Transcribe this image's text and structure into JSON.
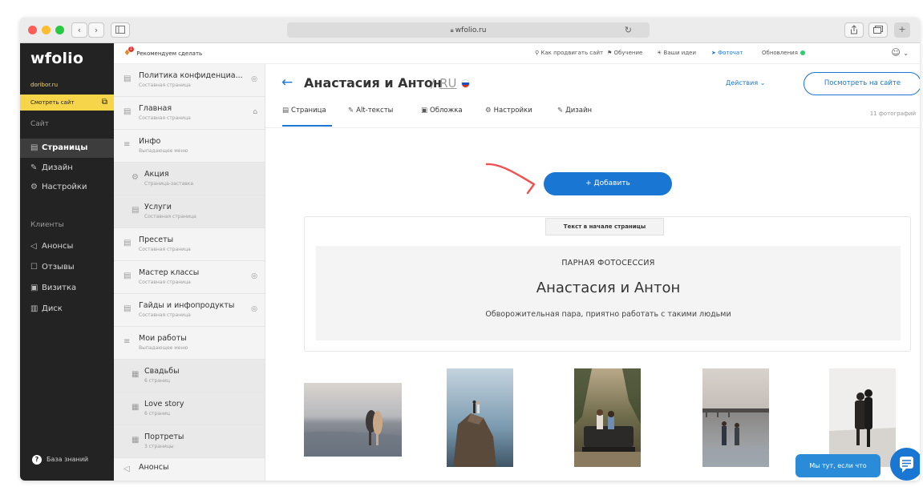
{
  "browser": {
    "url": "wfolio.ru",
    "nav_back": "‹",
    "nav_forward": "›"
  },
  "sidebar": {
    "logo": "wfolio",
    "domain": "doribor.ru",
    "view_site": "Смотреть сайт",
    "section_site": "Сайт",
    "items_site": [
      {
        "label": "Страницы",
        "icon": "page-icon"
      },
      {
        "label": "Дизайн",
        "icon": "brush-icon"
      },
      {
        "label": "Настройки",
        "icon": "gear-icon"
      }
    ],
    "section_clients": "Клиенты",
    "items_clients": [
      {
        "label": "Анонсы",
        "icon": "megaphone-icon"
      },
      {
        "label": "Отзывы",
        "icon": "chat-icon"
      },
      {
        "label": "Визитка",
        "icon": "card-icon"
      },
      {
        "label": "Диск",
        "icon": "disk-icon"
      }
    ],
    "knowledge": "База знаний"
  },
  "topbar": {
    "recommend": "Рекомендуем сделать",
    "badge": "1",
    "links": [
      {
        "label": "Как продвигать сайт"
      },
      {
        "label": "Обучение"
      },
      {
        "label": "Ваши идеи"
      },
      {
        "label": "Фоточат"
      },
      {
        "label": "Обновления"
      }
    ]
  },
  "pages_panel": {
    "items": [
      {
        "title": "Политика конфиденциа...",
        "subtitle": "Составная страница",
        "icon": "page-icon",
        "hidden_icon": true
      },
      {
        "title": "Главная",
        "subtitle": "Составная страница",
        "icon": "page-icon",
        "home_icon": true
      },
      {
        "title": "Инфо",
        "subtitle": "Выпадающее меню",
        "icon": "menu-icon"
      },
      {
        "title": "Акция",
        "subtitle": "Страница-заставка",
        "icon": "splash-icon"
      },
      {
        "title": "Услуги",
        "subtitle": "Составная страница",
        "icon": "page-icon"
      },
      {
        "title": "Пресеты",
        "subtitle": "Составная страница",
        "icon": "page-icon"
      },
      {
        "title": "Мастер классы",
        "subtitle": "Составная страница",
        "icon": "page-icon",
        "hidden_icon": true
      },
      {
        "title": "Гайды и инфопродукты",
        "subtitle": "Составная страница",
        "icon": "page-icon",
        "hidden_icon": true
      },
      {
        "title": "Мои работы",
        "subtitle": "Выпадающее меню",
        "icon": "menu-icon"
      },
      {
        "title": "Свадьбы",
        "subtitle": "6 страниц",
        "icon": "grid-icon"
      },
      {
        "title": "Love story",
        "subtitle": "6 страниц",
        "icon": "grid-icon"
      },
      {
        "title": "Портреты",
        "subtitle": "3 страницы",
        "icon": "grid-icon"
      },
      {
        "title": "Анонсы",
        "subtitle": "",
        "icon": "megaphone-icon"
      }
    ]
  },
  "page": {
    "back": "←",
    "title": "Анастасия и Антон",
    "slash": "/",
    "lang": "RU",
    "actions": "Действия",
    "view_on_site": "Посмотреть на сайте",
    "photo_count": "11 фотографий",
    "tabs": [
      {
        "label": "Страница",
        "icon": "page-icon"
      },
      {
        "label": "Alt-тексты",
        "icon": "edit-icon"
      },
      {
        "label": "Обложка",
        "icon": "image-icon"
      },
      {
        "label": "Настройки",
        "icon": "gear-icon"
      },
      {
        "label": "Дизайн",
        "icon": "brush-icon"
      }
    ],
    "add_button": "+ Добавить",
    "text_block": {
      "label": "Текст в начале страницы",
      "kicker": "ПАРНАЯ ФОТОСЕССИЯ",
      "heading": "Анастасия и Антон",
      "description": "Обворожительная пара, приятно работать с такими людьми"
    },
    "chat_bubble": "Мы тут, если что"
  },
  "colors": {
    "accent": "#1976d2",
    "sidebar_bg": "#232323",
    "highlight": "#f7d54a",
    "arrow": "#ef5350"
  }
}
